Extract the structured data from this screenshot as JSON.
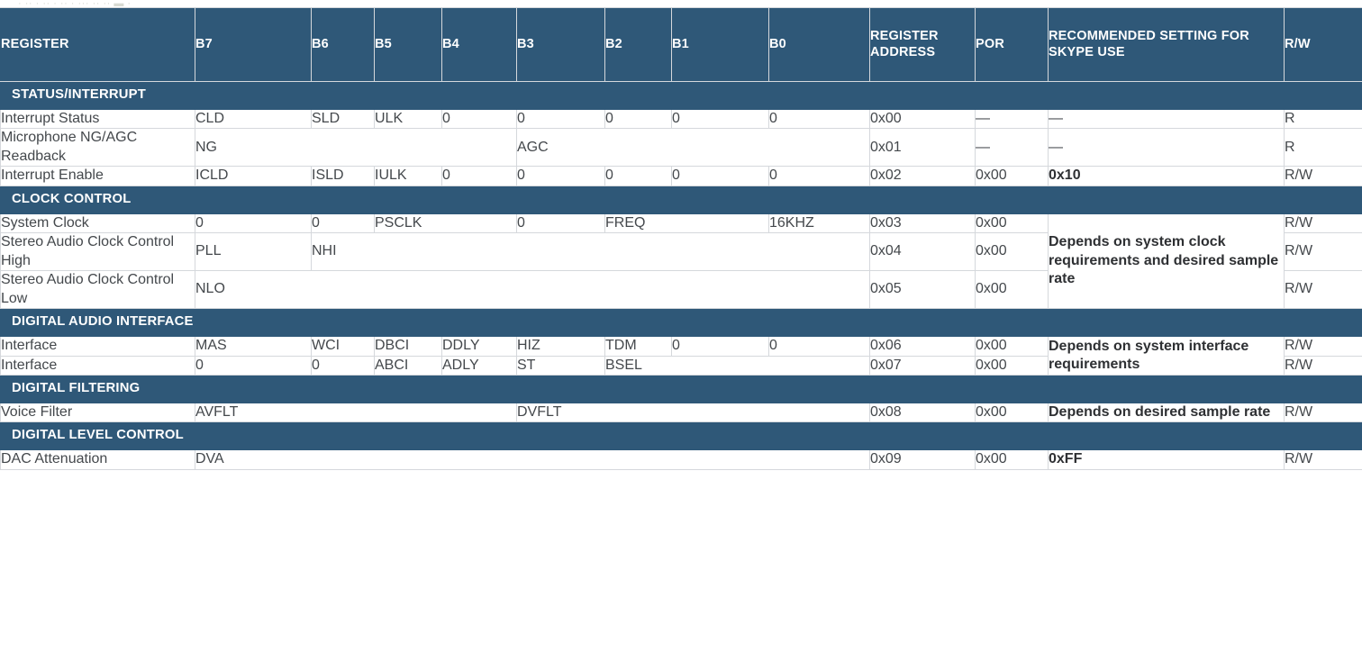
{
  "top_strip_text": "· ·· · ·· ·  ··  · ···   ··  ··    ▬ ·",
  "colors": {
    "header_background": "#2f5878",
    "header_text": "#ffffff",
    "section_band_background": "#2f5878",
    "section_band_text": "#ffffff",
    "cell_text": "#44484c",
    "grid_line": "#d5d8dc",
    "page_background": "#ffffff"
  },
  "table": {
    "columns": [
      {
        "key": "register",
        "label": "REGISTER"
      },
      {
        "key": "b7",
        "label": "B7"
      },
      {
        "key": "b6",
        "label": "B6"
      },
      {
        "key": "b5",
        "label": "B5"
      },
      {
        "key": "b4",
        "label": "B4"
      },
      {
        "key": "b3",
        "label": "B3"
      },
      {
        "key": "b2",
        "label": "B2"
      },
      {
        "key": "b1",
        "label": "B1"
      },
      {
        "key": "b0",
        "label": "B0"
      },
      {
        "key": "address",
        "label": "REGISTER ADDRESS"
      },
      {
        "key": "por",
        "label": "POR"
      },
      {
        "key": "recommended",
        "label": "RECOMMENDED SETTING FOR SKYPE USE"
      },
      {
        "key": "rw",
        "label": "R/W"
      }
    ],
    "sections": [
      {
        "title": "STATUS/INTERRUPT",
        "rows": [
          {
            "register": "Interrupt Status",
            "bits": [
              {
                "text": "CLD",
                "span": 1
              },
              {
                "text": "SLD",
                "span": 1
              },
              {
                "text": "ULK",
                "span": 1
              },
              {
                "text": "0",
                "span": 1
              },
              {
                "text": "0",
                "span": 1
              },
              {
                "text": "0",
                "span": 1
              },
              {
                "text": "0",
                "span": 1
              },
              {
                "text": "0",
                "span": 1
              }
            ],
            "address": "0x00",
            "por": "—",
            "recommended": "—",
            "recommended_bold": false,
            "rw": "R"
          },
          {
            "register": "Microphone NG/AGC Readback",
            "bits": [
              {
                "text": "NG",
                "span": 4
              },
              {
                "text": "AGC",
                "span": 4
              }
            ],
            "address": "0x01",
            "por": "—",
            "recommended": "—",
            "recommended_bold": false,
            "rw": "R"
          },
          {
            "register": "Interrupt Enable",
            "bits": [
              {
                "text": "ICLD",
                "span": 1
              },
              {
                "text": "ISLD",
                "span": 1
              },
              {
                "text": "IULK",
                "span": 1
              },
              {
                "text": "0",
                "span": 1
              },
              {
                "text": "0",
                "span": 1
              },
              {
                "text": "0",
                "span": 1
              },
              {
                "text": "0",
                "span": 1
              },
              {
                "text": "0",
                "span": 1
              }
            ],
            "address": "0x02",
            "por": "0x00",
            "recommended": "0x10",
            "recommended_bold": true,
            "rw": "R/W"
          }
        ]
      },
      {
        "title": "CLOCK CONTROL",
        "merged_recommended": {
          "text": "Depends on system clock requirements and desired sample rate",
          "bold": true,
          "rowspan": 3
        },
        "rows": [
          {
            "register": "System Clock",
            "bits": [
              {
                "text": "0",
                "span": 1
              },
              {
                "text": "0",
                "span": 1
              },
              {
                "text": "PSCLK",
                "span": 2
              },
              {
                "text": "0",
                "span": 1
              },
              {
                "text": "FREQ",
                "span": 2
              },
              {
                "text": "16KHZ",
                "span": 1
              }
            ],
            "address": "0x03",
            "por": "0x00",
            "rw": "R/W"
          },
          {
            "register": "Stereo Audio Clock Control High",
            "bits": [
              {
                "text": "PLL",
                "span": 1
              },
              {
                "text": "NHI",
                "span": 7
              }
            ],
            "address": "0x04",
            "por": "0x00",
            "rw": "R/W"
          },
          {
            "register": "Stereo Audio Clock Control Low",
            "bits": [
              {
                "text": "NLO",
                "span": 8
              }
            ],
            "address": "0x05",
            "por": "0x00",
            "rw": "R/W"
          }
        ]
      },
      {
        "title": "DIGITAL AUDIO INTERFACE",
        "merged_recommended": {
          "text": "Depends on system interface requirements",
          "bold": true,
          "rowspan": 2
        },
        "rows": [
          {
            "register": "Interface",
            "bits": [
              {
                "text": "MAS",
                "span": 1
              },
              {
                "text": "WCI",
                "span": 1
              },
              {
                "text": "DBCI",
                "span": 1
              },
              {
                "text": "DDLY",
                "span": 1
              },
              {
                "text": "HIZ",
                "span": 1
              },
              {
                "text": "TDM",
                "span": 1
              },
              {
                "text": "0",
                "span": 1
              },
              {
                "text": "0",
                "span": 1
              }
            ],
            "address": "0x06",
            "por": "0x00",
            "rw": "R/W"
          },
          {
            "register": "Interface",
            "bits": [
              {
                "text": "0",
                "span": 1
              },
              {
                "text": "0",
                "span": 1
              },
              {
                "text": "ABCI",
                "span": 1
              },
              {
                "text": "ADLY",
                "span": 1
              },
              {
                "text": "ST",
                "span": 1
              },
              {
                "text": "BSEL",
                "span": 3
              }
            ],
            "address": "0x07",
            "por": "0x00",
            "rw": "R/W"
          }
        ]
      },
      {
        "title": "DIGITAL FILTERING",
        "rows": [
          {
            "register": "Voice Filter",
            "bits": [
              {
                "text": "AVFLT",
                "span": 4
              },
              {
                "text": "DVFLT",
                "span": 4
              }
            ],
            "address": "0x08",
            "por": "0x00",
            "recommended": "Depends on desired sample rate",
            "recommended_bold": true,
            "rw": "R/W"
          }
        ]
      },
      {
        "title": "DIGITAL LEVEL CONTROL",
        "rows": [
          {
            "register": "DAC Attenuation",
            "bits": [
              {
                "text": "DVA",
                "span": 8
              }
            ],
            "address": "0x09",
            "por": "0x00",
            "recommended": "0xFF",
            "recommended_bold": true,
            "rw": "R/W"
          }
        ]
      }
    ]
  }
}
